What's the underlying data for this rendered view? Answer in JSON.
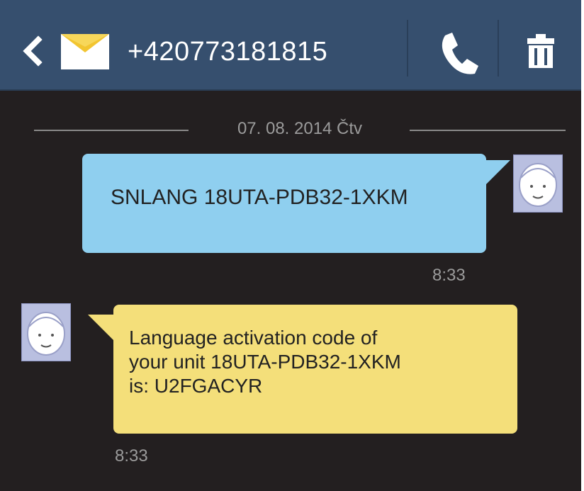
{
  "header": {
    "contact_number": "+420773181815",
    "icons": [
      "back-arrow-icon",
      "envelope-icon",
      "phone-icon",
      "trash-icon"
    ]
  },
  "conversation": {
    "date_divider": "07. 08. 2014 Čtv",
    "messages": [
      {
        "direction": "sent",
        "lines": [
          "SNLANG 18UTA-PDB32-1XKM"
        ],
        "time": "8:33",
        "bubble_color": "#8fcfef"
      },
      {
        "direction": "received",
        "lines": [
          "Language activation code of",
          "your unit 18UTA-PDB32-1XKM",
          "is: U2FGACYR"
        ],
        "time": "8:33",
        "bubble_color": "#f4df7a"
      }
    ]
  },
  "colors": {
    "header_bg": "#364f6e",
    "screen_bg": "#231f20",
    "timestamp": "#9b9b9b"
  }
}
